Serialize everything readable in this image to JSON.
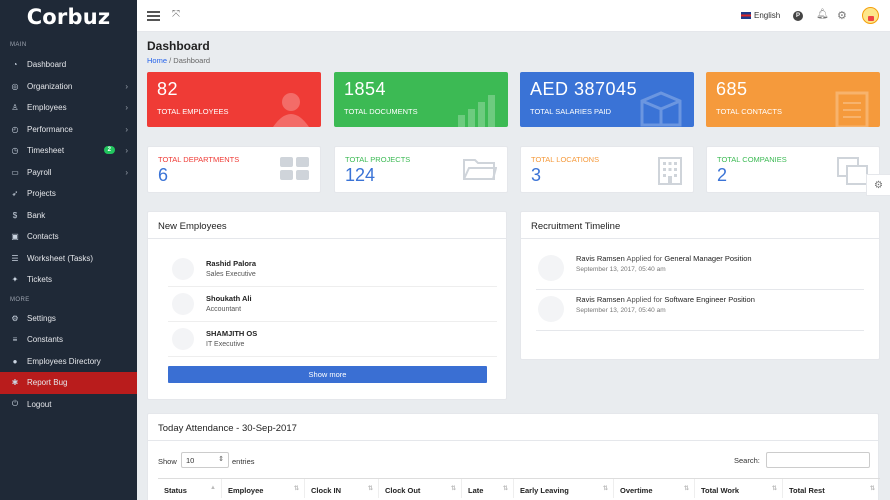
{
  "app": {
    "logo": "Corbuz"
  },
  "sidebar": {
    "main_label": "MAIN",
    "more_label": "MORE",
    "items": [
      {
        "label": "Dashboard",
        "icon": "speedometer-icon",
        "chevron": false
      },
      {
        "label": "Organization",
        "icon": "globe-icon",
        "chevron": true
      },
      {
        "label": "Employees",
        "icon": "user-icon",
        "chevron": true
      },
      {
        "label": "Performance",
        "icon": "gauge-icon",
        "chevron": true
      },
      {
        "label": "Timesheet",
        "icon": "clock-icon",
        "chevron": true,
        "badge": "2"
      },
      {
        "label": "Payroll",
        "icon": "card-icon",
        "chevron": true
      },
      {
        "label": "Projects",
        "icon": "rocket-icon",
        "chevron": false
      },
      {
        "label": "Bank",
        "icon": "dollar-icon",
        "chevron": false
      },
      {
        "label": "Contacts",
        "icon": "contact-card-icon",
        "chevron": false
      },
      {
        "label": "Worksheet (Tasks)",
        "icon": "list-icon",
        "chevron": false
      },
      {
        "label": "Tickets",
        "icon": "ticket-icon",
        "chevron": false
      }
    ],
    "more_items": [
      {
        "label": "Settings",
        "icon": "gear-icon"
      },
      {
        "label": "Constants",
        "icon": "sliders-icon"
      },
      {
        "label": "Employees Directory",
        "icon": "person-icon"
      },
      {
        "label": "Report Bug",
        "icon": "bug-icon",
        "active": true
      },
      {
        "label": "Logout",
        "icon": "logout-icon"
      }
    ]
  },
  "topbar": {
    "language": "English",
    "profile_letter": "P"
  },
  "page": {
    "title": "Dashboard",
    "breadcrumb_home": "Home",
    "breadcrumb_sep": "/",
    "breadcrumb_current": "Dashboard"
  },
  "stats": [
    {
      "value": "82",
      "label": "TOTAL EMPLOYEES",
      "color": "#ef3b36"
    },
    {
      "value": "1854",
      "label": "TOTAL DOCUMENTS",
      "color": "#3cba54"
    },
    {
      "value": "AED 387045",
      "label": "TOTAL SALARIES PAID",
      "color": "#3a73d6"
    },
    {
      "value": "685",
      "label": "TOTAL CONTACTS",
      "color": "#f59a3c"
    }
  ],
  "white_stats": [
    {
      "value": "6",
      "label": "TOTAL DEPARTMENTS",
      "color": "#ef3b36",
      "num_color": "#3a73d6"
    },
    {
      "value": "124",
      "label": "TOTAL PROJECTS",
      "color": "#3cba54",
      "num_color": "#3a73d6"
    },
    {
      "value": "3",
      "label": "TOTAL LOCATIONS",
      "color": "#f59a3c",
      "num_color": "#3a73d6"
    },
    {
      "value": "2",
      "label": "TOTAL COMPANIES",
      "color": "#3cba54",
      "num_color": "#3a73d6"
    }
  ],
  "new_employees": {
    "title_bold": "New",
    "title_rest": "Employees",
    "rows": [
      {
        "name": "Rashid Palora",
        "role": "Sales Executive"
      },
      {
        "name": "Shoukath Ali",
        "role": "Accountant"
      },
      {
        "name": "SHAMJITH OS",
        "role": "IT Executive"
      }
    ],
    "show_more": "Show more"
  },
  "timeline": {
    "title_bold": "Recruitment",
    "title_rest": "Timeline",
    "rows": [
      {
        "name": "Ravis Ramsen",
        "applied": "Applied for",
        "position": "General Manager",
        "suffix": "Position",
        "date": "September 13, 2017, 05:40 am"
      },
      {
        "name": "Ravis Ramsen",
        "applied": "Applied for",
        "position": "Software Engineer",
        "suffix": "Position",
        "date": "September 13, 2017, 05:40 am"
      }
    ]
  },
  "attendance": {
    "title": "Today Attendance - 30-Sep-2017",
    "show_label": "Show",
    "show_value": "10",
    "entries_label": "entries",
    "search_label": "Search:",
    "columns": [
      "Status",
      "Employee",
      "Clock IN",
      "Clock Out",
      "Late",
      "Early Leaving",
      "Overtime",
      "Total Work",
      "Total Rest"
    ]
  }
}
